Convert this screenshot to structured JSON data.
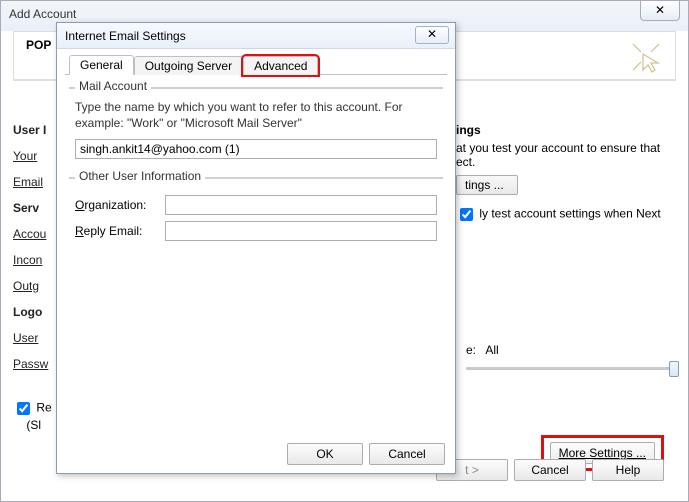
{
  "outer": {
    "title": "Add Account",
    "close_glyph": "✕",
    "pop_title": "POP",
    "left": {
      "user_section": "User I",
      "your": "Your",
      "email": "Email",
      "serv_section": "Serv",
      "accou": "Accou",
      "incon": "Incon",
      "outg": "Outg",
      "logo_section": "Logo",
      "user": "User",
      "passw": "Passw"
    },
    "right": {
      "ings_title": "ings",
      "desc1": "at you test your account to ensure that",
      "desc2": "ect.",
      "btn_label": "tings ...",
      "check_label": "ly test account settings when Next",
      "slider_label_prefix": "e:",
      "slider_value": "All"
    },
    "left_check": {
      "r_label": "Re",
      "s_label": "(Sl"
    },
    "more_settings": "More Settings ...",
    "footer": {
      "next": "t >",
      "cancel": "Cancel",
      "help": "Help"
    }
  },
  "dialog": {
    "title": "Internet Email Settings",
    "close_glyph": "✕",
    "tabs": {
      "general": "General",
      "outgoing": "Outgoing Server",
      "advanced": "Advanced"
    },
    "mail_account": {
      "legend": "Mail Account",
      "desc": "Type the name by which you want to refer to this account. For example: \"Work\" or \"Microsoft Mail Server\"",
      "value": "singh.ankit14@yahoo.com (1)"
    },
    "other_info": {
      "legend": "Other User Information",
      "org_label": "Organization:",
      "org_value": "",
      "reply_label": "Reply Email:",
      "reply_value": ""
    },
    "buttons": {
      "ok": "OK",
      "cancel": "Cancel"
    }
  }
}
